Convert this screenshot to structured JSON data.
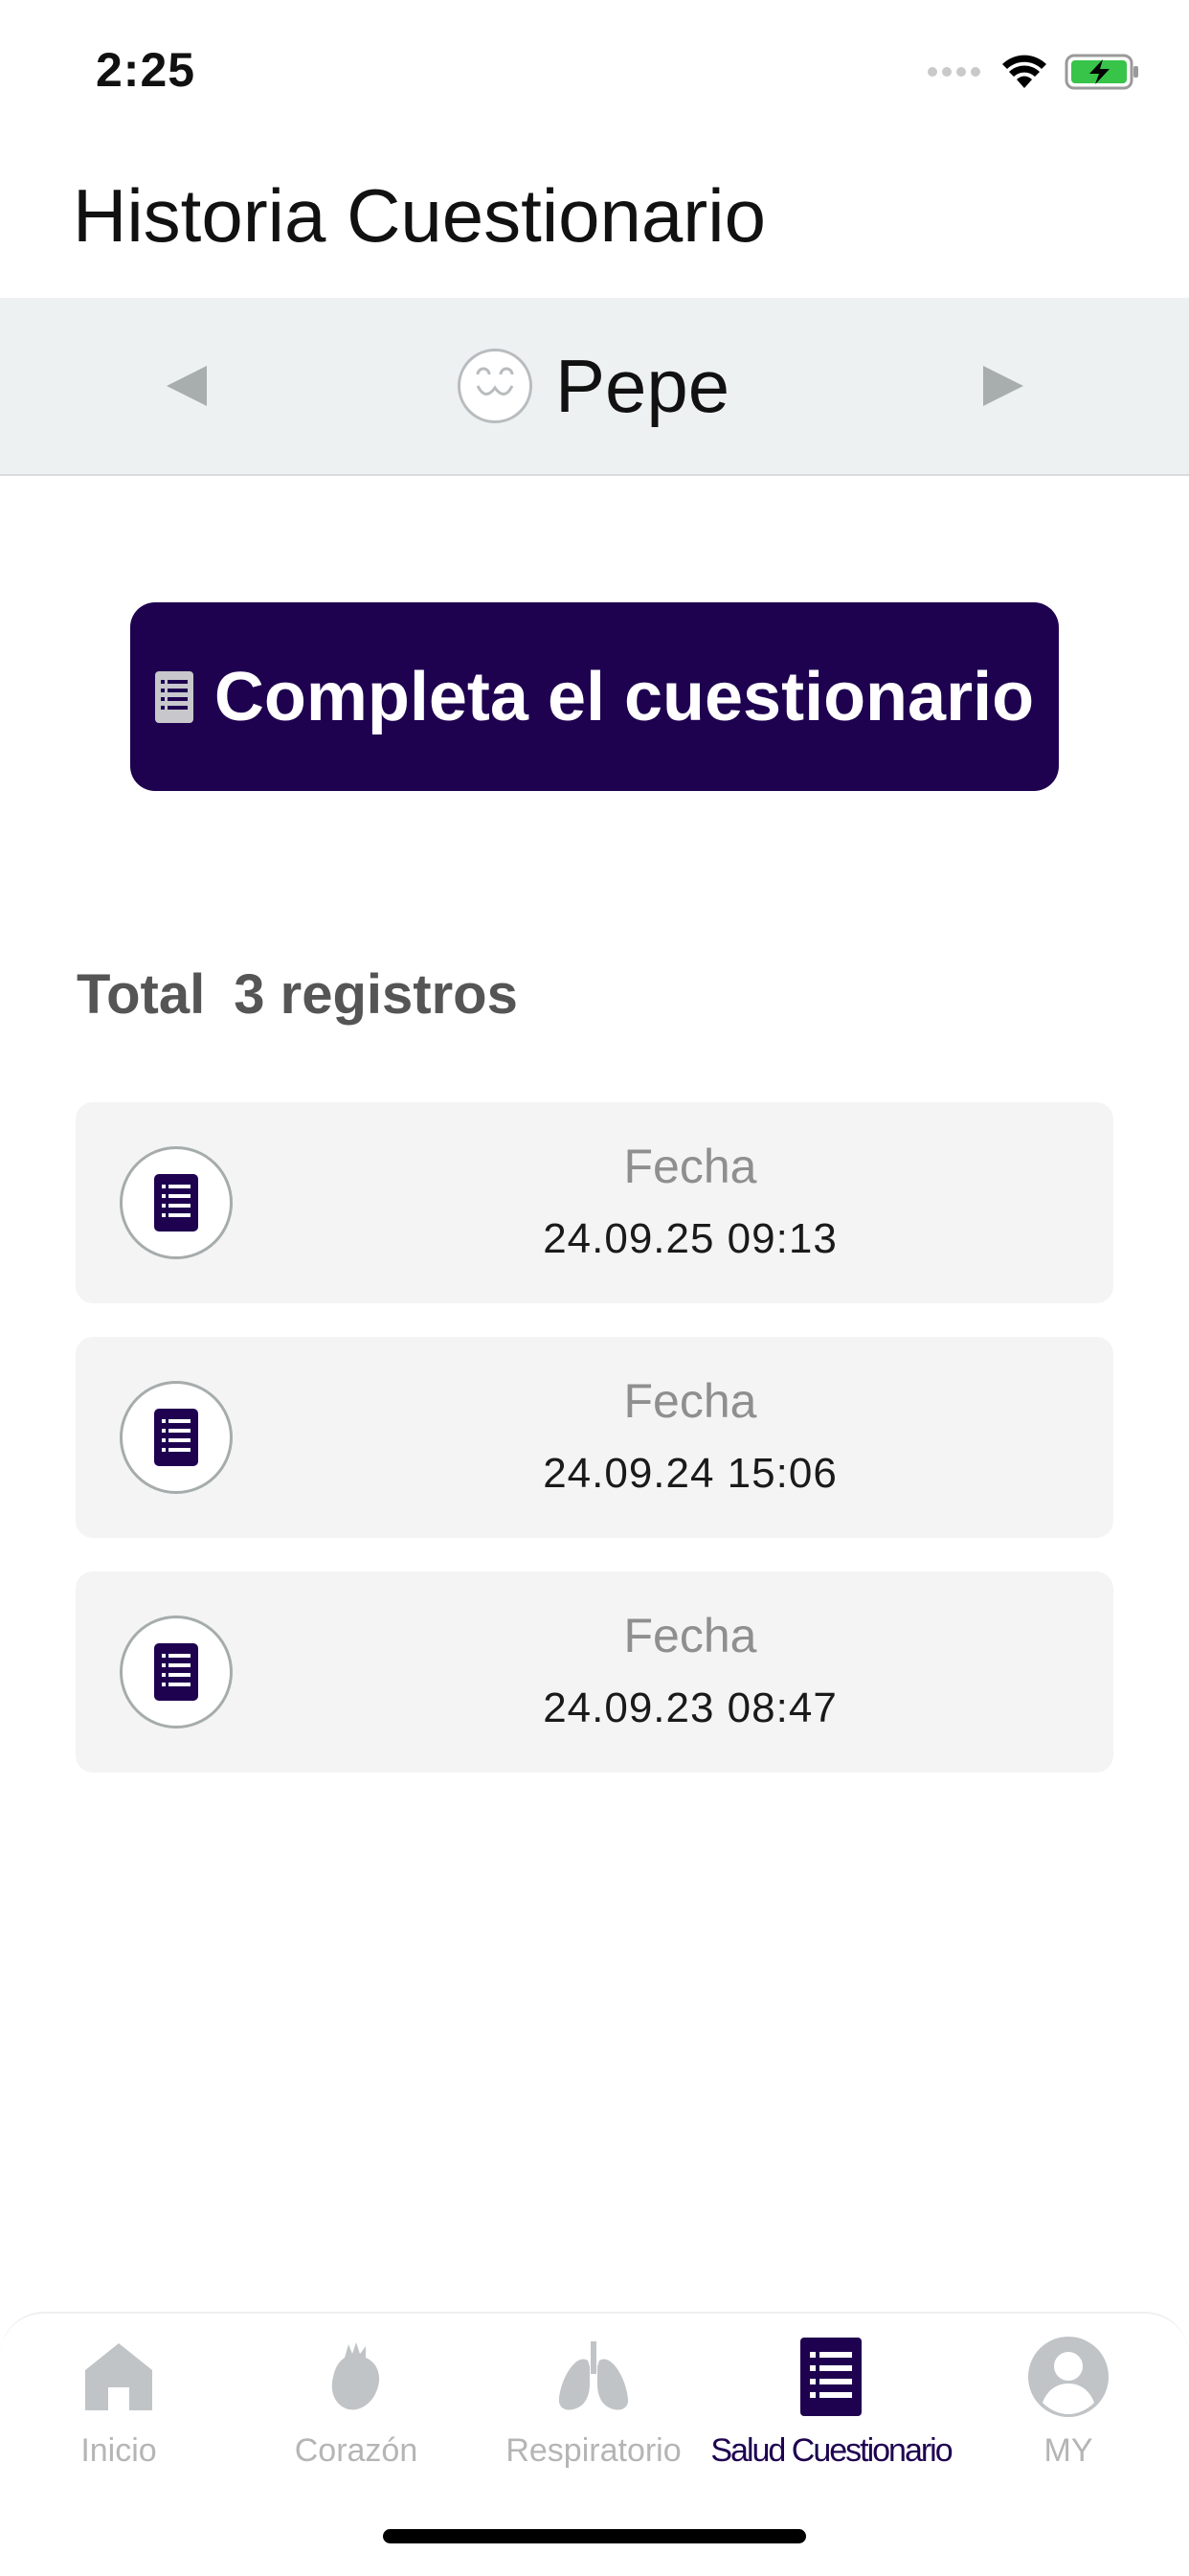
{
  "status_bar": {
    "time": "2:25",
    "icons": [
      "signal-dots-icon",
      "wifi-icon",
      "battery-charging-icon"
    ],
    "battery_color": "#38c449"
  },
  "header": {
    "title": "Historia Cuestionario"
  },
  "profile_selector": {
    "name": "Pepe",
    "prev_icon": "triangle-left-icon",
    "next_icon": "triangle-right-icon",
    "avatar_icon": "face-avatar-icon"
  },
  "cta": {
    "label": "Completa el cuestionario",
    "icon": "list-document-icon",
    "color": "#1e0250"
  },
  "summary": {
    "label": "Total",
    "count_text": "3 registros"
  },
  "records": [
    {
      "label": "Fecha",
      "date": "24.09.25 09:13"
    },
    {
      "label": "Fecha",
      "date": "24.09.24 15:06"
    },
    {
      "label": "Fecha",
      "date": "24.09.23 08:47"
    }
  ],
  "tabs": [
    {
      "label": "Inicio",
      "icon": "home-icon",
      "active": false
    },
    {
      "label": "Corazón",
      "icon": "heart-icon",
      "active": false
    },
    {
      "label": "Respiratorio",
      "icon": "lungs-icon",
      "active": false
    },
    {
      "label": "Salud Cuestionario",
      "icon": "list-icon",
      "active": true
    },
    {
      "label": "MY",
      "icon": "user-icon",
      "active": false
    }
  ],
  "colors": {
    "accent": "#1e0250",
    "inactive": "#b5b5b5",
    "profile_bar_bg": "#eef1f2"
  }
}
